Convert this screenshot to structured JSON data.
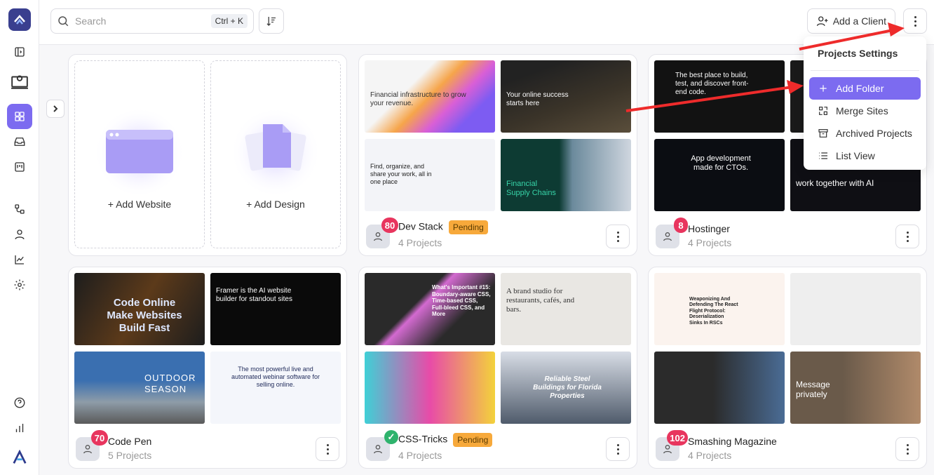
{
  "search": {
    "placeholder": "Search",
    "shortcut": "Ctrl + K"
  },
  "header": {
    "add_client_label": "Add a Client"
  },
  "menu": {
    "title": "Projects Settings",
    "items": [
      {
        "label": "Add Folder",
        "icon": "plus-icon"
      },
      {
        "label": "Merge Sites",
        "icon": "merge-icon"
      },
      {
        "label": "Archived Projects",
        "icon": "archive-icon"
      },
      {
        "label": "List View",
        "icon": "list-icon"
      }
    ]
  },
  "add_card": {
    "website_label": "+ Add Website",
    "design_label": "+ Add Design"
  },
  "projects": [
    {
      "name": "Dev Stack",
      "count": "80",
      "status": "Pending",
      "sub": "4 Projects",
      "thumbs": [
        "Financial infrastructure to grow your revenue.",
        "Your online success starts here",
        "Find, organize, and share your work, all in one place",
        "Financial Supply Chains"
      ]
    },
    {
      "name": "Hostinger",
      "count": "8",
      "status": "",
      "sub": "4 Projects",
      "thumbs": [
        "The best place to build, test, and discover front-end code.",
        "",
        "App development made for CTOs.",
        "work together with AI"
      ]
    },
    {
      "name": "Code Pen",
      "count": "70",
      "status": "",
      "sub": "5 Projects",
      "thumbs": [
        "Code Online Make Websites Build Fast",
        "Framer is the AI website builder for standout sites",
        "OUTDOOR SEASON",
        "The most powerful live and automated webinar software for selling online."
      ]
    },
    {
      "name": "CSS-Tricks",
      "count": "✓",
      "status": "Pending",
      "sub": "4 Projects",
      "thumbs": [
        "What's Important #15: Boundary-aware CSS, Time-based CSS, Full-bleed CSS, and More",
        "A brand studio for restaurants, cafés, and bars.",
        "",
        "Reliable Steel Buildings for Florida Properties"
      ]
    },
    {
      "name": "Smashing Magazine",
      "count": "102",
      "status": "",
      "sub": "4 Projects",
      "thumbs": [
        "Weaponizing And Defending The React Flight Protocol: Deserialization Sinks In RSCs",
        "",
        "",
        "Message privately"
      ]
    }
  ]
}
